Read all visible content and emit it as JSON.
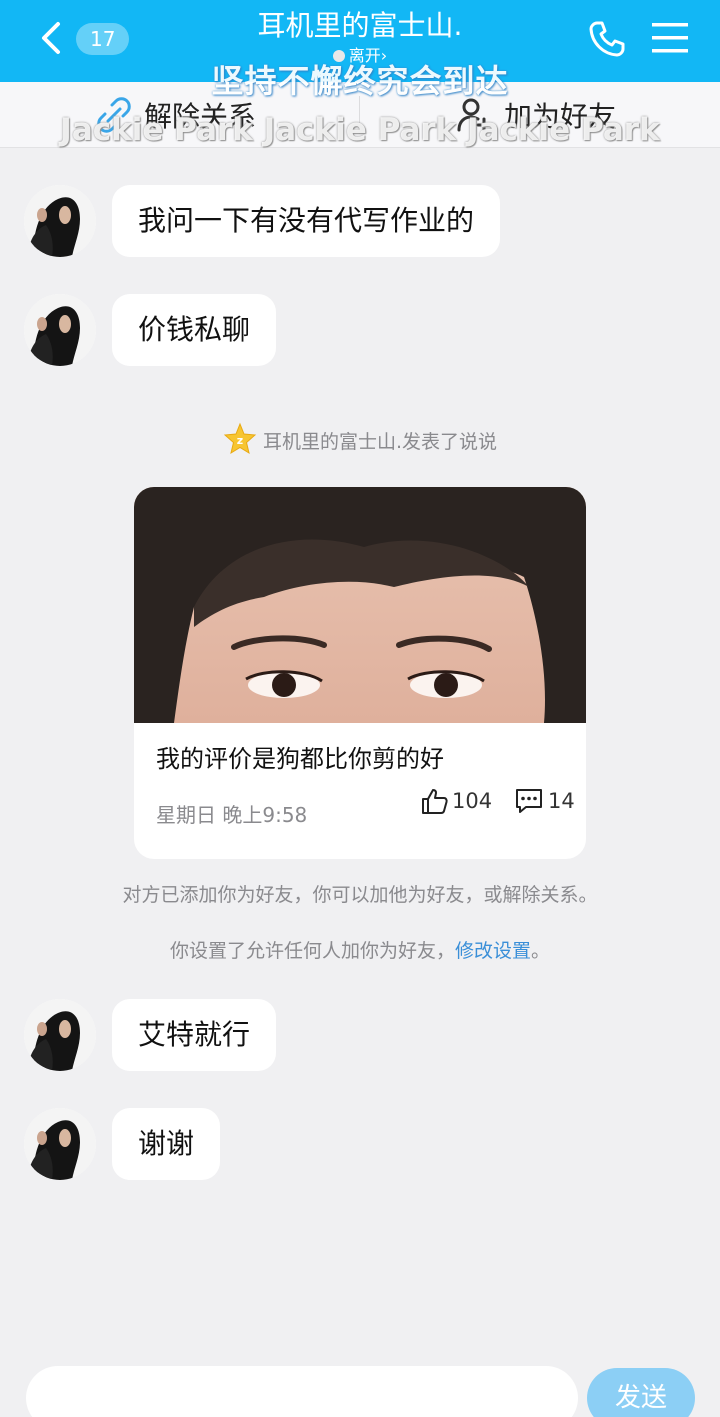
{
  "header": {
    "unread_count": "17",
    "title": "耳机里的富士山.",
    "status": "离开",
    "status_arrow": "›",
    "back_icon": "chevron-left-icon",
    "call_icon": "phone-icon",
    "menu_icon": "menu-icon",
    "accent": "#12b7f5"
  },
  "overlay": {
    "line1": "坚持不懈终究会到达",
    "line2": "Jackie Park Jackie Park Jackie Park"
  },
  "action_bar": {
    "unbind_label": "解除关系",
    "add_friend_label": "加为好友"
  },
  "messages": [
    {
      "text": "我问一下有没有代写作业的"
    },
    {
      "text": "价钱私聊"
    },
    {
      "text": "艾特就行"
    },
    {
      "text": "谢谢"
    }
  ],
  "feed_notice": "耳机里的富士山.发表了说说",
  "share_card": {
    "caption": "我的评价是狗都比你剪的好",
    "time": "星期日 晚上9:58",
    "likes": "104",
    "comments": "14"
  },
  "system": {
    "friend_notice": "对方已添加你为好友，你可以加他为好友，或解除关系。",
    "setting_notice_prefix": "你设置了允许任何人加你为好友，",
    "setting_link": "修改设置",
    "setting_notice_suffix": "。"
  },
  "input": {
    "placeholder": "",
    "send_label": "发送",
    "send_color": "#8ccff5"
  }
}
